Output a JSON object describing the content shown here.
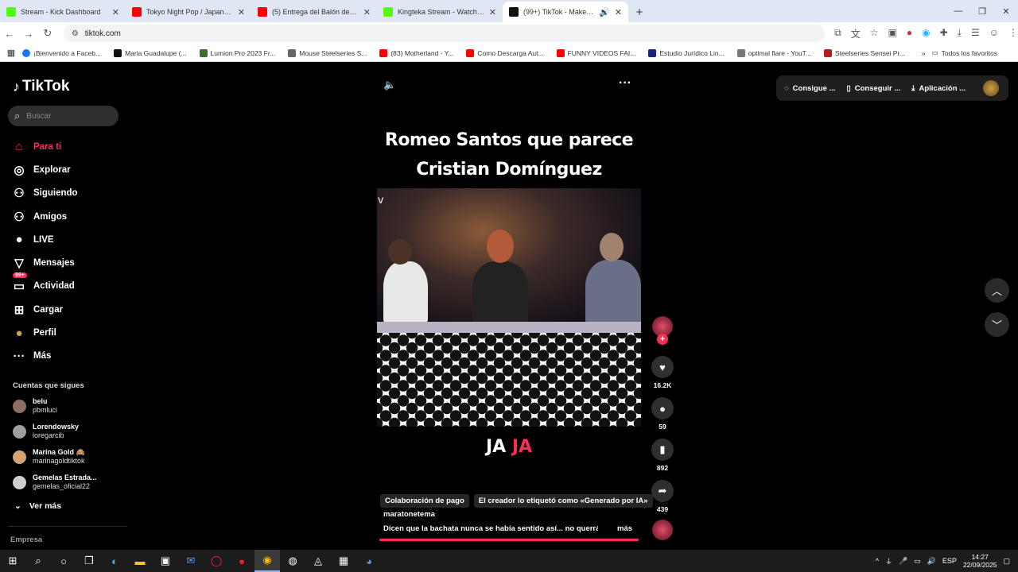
{
  "browser": {
    "tabs": [
      {
        "title": "Stream - Kick Dashboard",
        "color": "#53fc18"
      },
      {
        "title": "Tokyo Night Pop / Japanese Ne",
        "color": "#ff0000"
      },
      {
        "title": "(5) Entrega del Balón de Oro 2(",
        "color": "#ff0000"
      },
      {
        "title": "Kingteka Stream - Watch Live c",
        "color": "#53fc18"
      },
      {
        "title": "(99+) TikTok - Make Your Da",
        "color": "#111111"
      }
    ],
    "url": "tiktok.com",
    "bookmarks": [
      {
        "title": "¡Bienvenido a Faceb...",
        "color": "#1877f2"
      },
      {
        "title": "Maria Guadalupe (...",
        "color": "#111111"
      },
      {
        "title": "Lumion Pro 2023 Fr...",
        "color": "#3c6e2f"
      },
      {
        "title": "Mouse Steelseries S...",
        "color": "#666666"
      },
      {
        "title": "(83) Motherland - Y...",
        "color": "#ff0000"
      },
      {
        "title": "Como Descarga Aut...",
        "color": "#ff0000"
      },
      {
        "title": "FUNNY VIDEOS FAI...",
        "color": "#ff0000"
      },
      {
        "title": "Estudio Jurídico Lin...",
        "color": "#1a237e"
      },
      {
        "title": "optimal flare - YouT...",
        "color": "#777777"
      },
      {
        "title": "Steelseries Sensei Pr...",
        "color": "#b71c1c"
      }
    ],
    "all_favorites": "Todos los favoritos"
  },
  "sidebar": {
    "logo": "TikTok",
    "search_placeholder": "Buscar",
    "items": [
      {
        "label": "Para ti",
        "icon": "⌂"
      },
      {
        "label": "Explorar",
        "icon": "◎"
      },
      {
        "label": "Siguiendo",
        "icon": "⚇"
      },
      {
        "label": "Amigos",
        "icon": "⚇"
      },
      {
        "label": "LIVE",
        "icon": "●"
      },
      {
        "label": "Mensajes",
        "icon": "▽"
      },
      {
        "label": "Actividad",
        "icon": "▭",
        "badge": "99+"
      },
      {
        "label": "Cargar",
        "icon": "⊞"
      },
      {
        "label": "Perfil",
        "icon": "●"
      },
      {
        "label": "Más",
        "icon": "···"
      }
    ],
    "following_title": "Cuentas que sigues",
    "accounts": [
      {
        "name": "belu",
        "handle": "pbmluci",
        "color": "#8d6e63"
      },
      {
        "name": "Lorendowsky",
        "handle": "loregarcib",
        "color": "#9e9e9e"
      },
      {
        "name": "Marina Gold 🙈",
        "handle": "marinagoldtiktok",
        "color": "#d4a373"
      },
      {
        "name": "Gemelas Estrada...",
        "handle": "gemelas_oficial22",
        "color": "#cfcfcf"
      }
    ],
    "see_more": "Ver más",
    "company": "Empresa"
  },
  "topbar": {
    "get_coins": "Consigue ...",
    "get_app": "Conseguir ...",
    "pc_app": "Aplicación ..."
  },
  "video": {
    "caption_line1": "Romeo Santos  que parece",
    "caption_line2": "Cristian Domínguez",
    "tv_mark": "V",
    "subtitle_a": "JA",
    "subtitle_b": "JA",
    "likes": "16.2K",
    "comments": "59",
    "saves": "892",
    "shares": "439",
    "tag_paid": "Colaboración de pago",
    "tag_ai": "El creador lo etiquetó como «Generado por IA»",
    "author": "maratonetema",
    "description": "Dicen que la bachata nunca se había sentido así... no querrás ...",
    "more": "más"
  },
  "taskbar": {
    "lang": "ESP",
    "time": "14:27",
    "date": "22/09/2025"
  }
}
